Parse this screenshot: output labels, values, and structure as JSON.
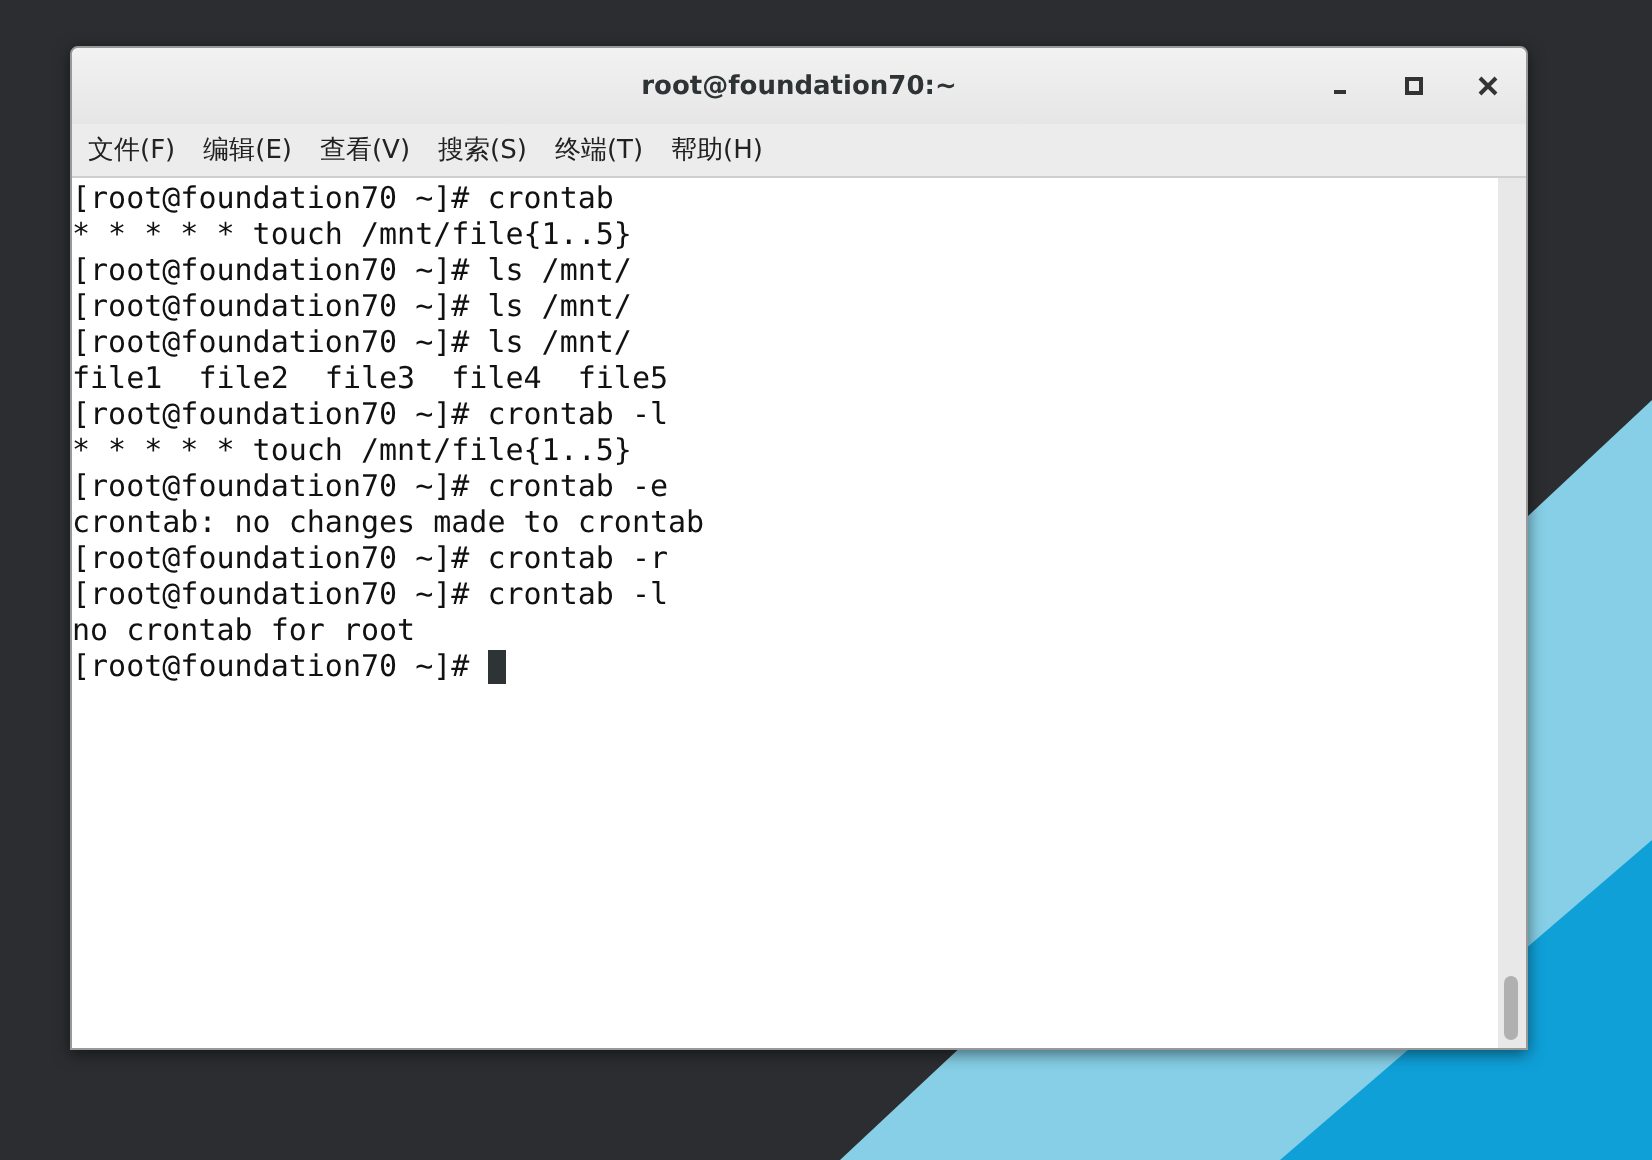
{
  "window": {
    "title": "root@foundation70:~"
  },
  "menu": [
    "文件(F)",
    "编辑(E)",
    "查看(V)",
    "搜索(S)",
    "终端(T)",
    "帮助(H)"
  ],
  "terminal": {
    "lines": [
      "[root@foundation70 ~]# crontab",
      "* * * * * touch /mnt/file{1..5}",
      "[root@foundation70 ~]# ls /mnt/",
      "[root@foundation70 ~]# ls /mnt/",
      "[root@foundation70 ~]# ls /mnt/",
      "file1  file2  file3  file4  file5",
      "[root@foundation70 ~]# crontab -l",
      "* * * * * touch /mnt/file{1..5}",
      "[root@foundation70 ~]# crontab -e",
      "crontab: no changes made to crontab",
      "[root@foundation70 ~]# crontab -r",
      "[root@foundation70 ~]# crontab -l",
      "no crontab for root",
      "[root@foundation70 ~]# "
    ]
  }
}
